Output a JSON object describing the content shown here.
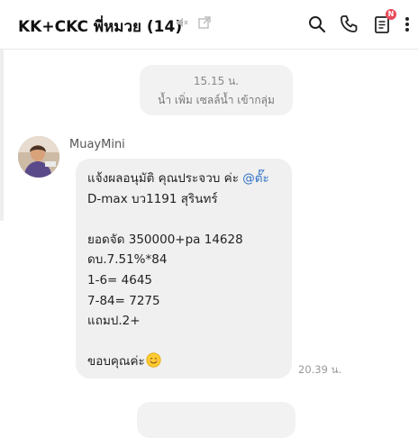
{
  "header": {
    "title": "KK+CKC พี่หมวย (14)",
    "badge": "N",
    "icons": [
      "mute-icon",
      "popout-icon",
      "search-icon",
      "phone-icon",
      "notes-icon",
      "more-icon"
    ]
  },
  "chat": {
    "system_message": {
      "time": "15.15 น.",
      "text": "น้ำ เพิ่ม เซลล์น้ำ เข้ากลุ่ม"
    },
    "message": {
      "sender": "MuayMini",
      "lines": {
        "l1_text": "แจ้งผลอนุมัติ คุณประจวบ ค่ะ ",
        "l1_mention": "@ตั๊ะ",
        "l2": "D-max บว1191 สุรินทร์",
        "l3": "",
        "l4": "ยอดจัด 350000+pa 14628",
        "l5": "ดบ.7.51%*84",
        "l6": "1-6= 4645",
        "l7": "7-84= 7275",
        "l8": "แถมป.2+",
        "l9": "",
        "l10": "ขอบคุณค่ะ"
      },
      "time": "20.39 น."
    }
  },
  "colors": {
    "mention": "#2b6fc4",
    "bubble": "#f0f0f0",
    "badge": "#e94a5a"
  }
}
